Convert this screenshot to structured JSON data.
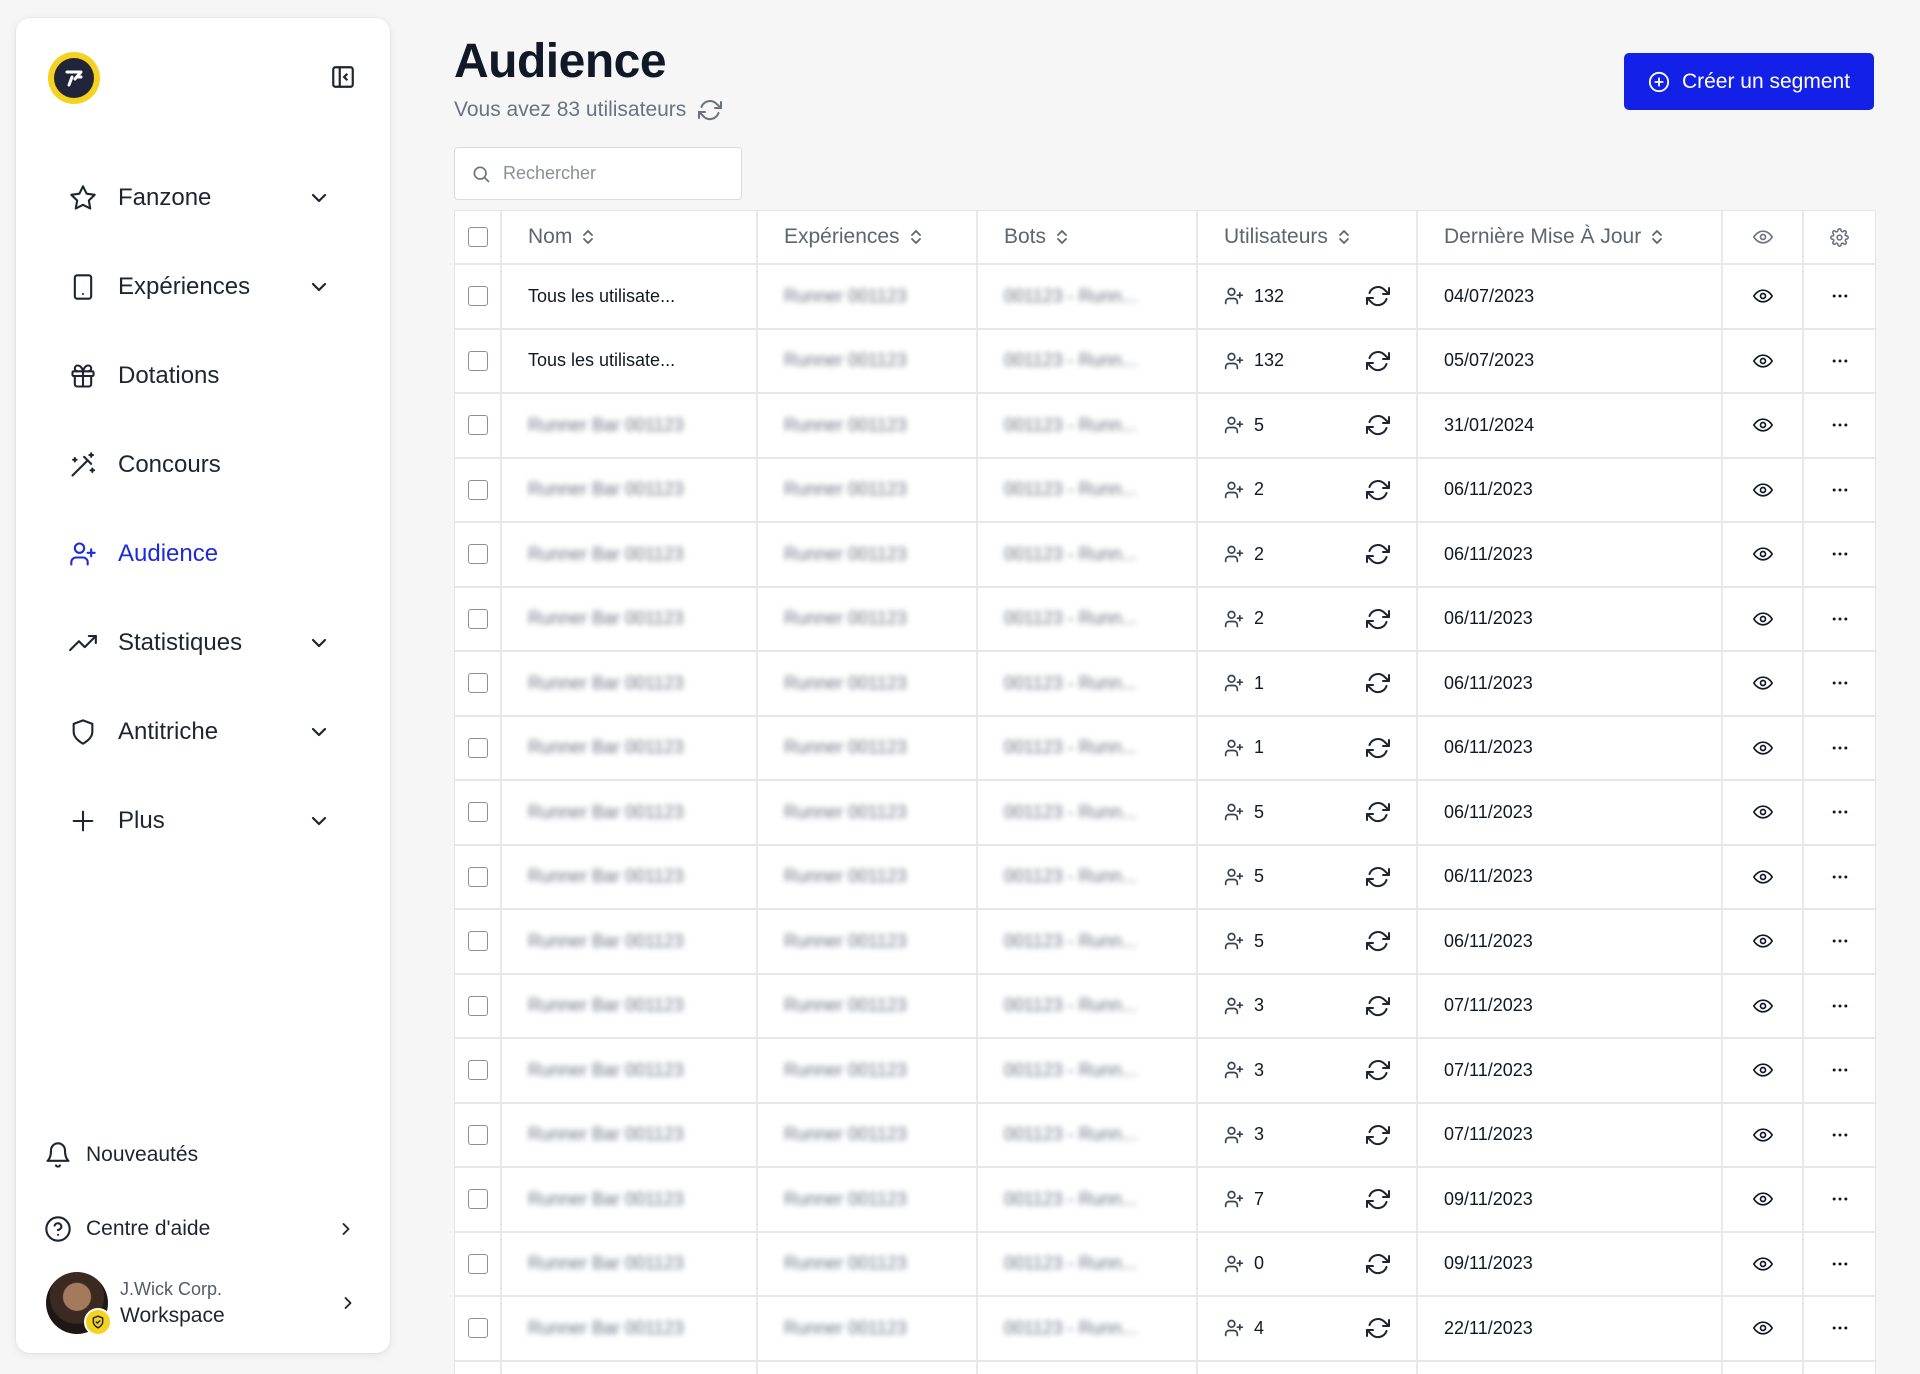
{
  "sidebar": {
    "nav": [
      {
        "label": "Fanzone",
        "icon": "star-icon",
        "has_chevron": true,
        "active": false
      },
      {
        "label": "Expériences",
        "icon": "phone-icon",
        "has_chevron": true,
        "active": false
      },
      {
        "label": "Dotations",
        "icon": "gift-icon",
        "has_chevron": false,
        "active": false
      },
      {
        "label": "Concours",
        "icon": "magic-wand-icon",
        "has_chevron": false,
        "active": false
      },
      {
        "label": "Audience",
        "icon": "user-plus-icon",
        "has_chevron": false,
        "active": true
      },
      {
        "label": "Statistiques",
        "icon": "trending-up-icon",
        "has_chevron": true,
        "active": false
      },
      {
        "label": "Antitriche",
        "icon": "shield-icon",
        "has_chevron": true,
        "active": false
      },
      {
        "label": "Plus",
        "icon": "plus-icon",
        "has_chevron": true,
        "active": false
      }
    ],
    "news_label": "Nouveautés",
    "help_label": "Centre d'aide",
    "workspace": {
      "org": "J.Wick Corp.",
      "name": "Workspace"
    }
  },
  "header": {
    "title": "Audience",
    "subtitle": "Vous avez 83 utilisateurs",
    "create_button": "Créer un segment"
  },
  "search": {
    "placeholder": "Rechercher"
  },
  "table": {
    "columns": [
      "Nom",
      "Expériences",
      "Bots",
      "Utilisateurs",
      "Dernière Mise À Jour"
    ],
    "blurred_name": "Runner Bar 001123",
    "blurred_experience": "Runner 001123",
    "blurred_bot": "001123 - Runn...",
    "rows": [
      {
        "name": "Tous les utilisate...",
        "name_blurred": false,
        "users": "132",
        "date": "04/07/2023"
      },
      {
        "name": "Tous les utilisate...",
        "name_blurred": false,
        "users": "132",
        "date": "05/07/2023"
      },
      {
        "name": "",
        "name_blurred": true,
        "users": "5",
        "date": "31/01/2024"
      },
      {
        "name": "",
        "name_blurred": true,
        "users": "2",
        "date": "06/11/2023"
      },
      {
        "name": "",
        "name_blurred": true,
        "users": "2",
        "date": "06/11/2023"
      },
      {
        "name": "",
        "name_blurred": true,
        "users": "2",
        "date": "06/11/2023"
      },
      {
        "name": "",
        "name_blurred": true,
        "users": "1",
        "date": "06/11/2023"
      },
      {
        "name": "",
        "name_blurred": true,
        "users": "1",
        "date": "06/11/2023"
      },
      {
        "name": "",
        "name_blurred": true,
        "users": "5",
        "date": "06/11/2023"
      },
      {
        "name": "",
        "name_blurred": true,
        "users": "5",
        "date": "06/11/2023"
      },
      {
        "name": "",
        "name_blurred": true,
        "users": "5",
        "date": "06/11/2023"
      },
      {
        "name": "",
        "name_blurred": true,
        "users": "3",
        "date": "07/11/2023"
      },
      {
        "name": "",
        "name_blurred": true,
        "users": "3",
        "date": "07/11/2023"
      },
      {
        "name": "",
        "name_blurred": true,
        "users": "3",
        "date": "07/11/2023"
      },
      {
        "name": "",
        "name_blurred": true,
        "users": "7",
        "date": "09/11/2023"
      },
      {
        "name": "",
        "name_blurred": true,
        "users": "0",
        "date": "09/11/2023"
      },
      {
        "name": "",
        "name_blurred": true,
        "users": "4",
        "date": "22/11/2023"
      },
      {
        "name": "",
        "name_blurred": true,
        "users": "",
        "date": ""
      }
    ]
  },
  "colors": {
    "accent": "#1320e8",
    "active_nav": "#1d2bdc",
    "logo_yellow": "#f4d21f",
    "logo_dark": "#22243a"
  }
}
